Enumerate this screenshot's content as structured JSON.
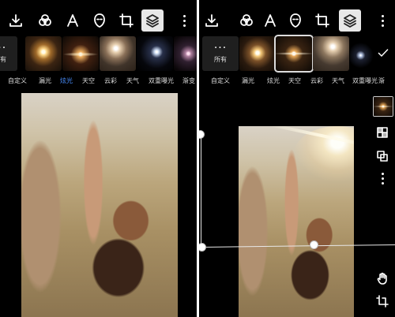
{
  "toolbar": {
    "tools": [
      {
        "name": "download",
        "icon": "download-icon"
      },
      {
        "name": "color",
        "icon": "color-circles-icon"
      },
      {
        "name": "text",
        "icon": "text-icon",
        "glyph": "A"
      },
      {
        "name": "mask",
        "icon": "face-mask-icon"
      },
      {
        "name": "crop",
        "icon": "crop-icon"
      },
      {
        "name": "layers",
        "icon": "layers-icon",
        "active": true
      },
      {
        "name": "more",
        "icon": "more-vertical-icon"
      }
    ],
    "active_color": "#e8e8e8"
  },
  "left_panel": {
    "none_thumb": {
      "dots": "···",
      "label": "所有"
    },
    "categories": [
      "自定义",
      "漏光",
      "炫光",
      "天空",
      "云彩",
      "天气",
      "双重曝光",
      "渐变"
    ],
    "active_category": "炫光",
    "active_category_color": "#4a8fff"
  },
  "right_panel": {
    "none_thumb": {
      "dots": "···",
      "label": "所有"
    },
    "categories": [
      "自定义",
      "漏光",
      "炫光",
      "天空",
      "云彩",
      "天气",
      "双重曝光",
      "渐"
    ],
    "selected_thumb_index": 2,
    "confirm_icon": "checkmark-icon",
    "side_tools": [
      "flare-preview-thumb",
      "checker-blend-icon",
      "duplicate-icon",
      "more-vertical-icon"
    ],
    "bottom_tools": [
      "hand-pan-icon",
      "crop-frame-icon"
    ]
  }
}
